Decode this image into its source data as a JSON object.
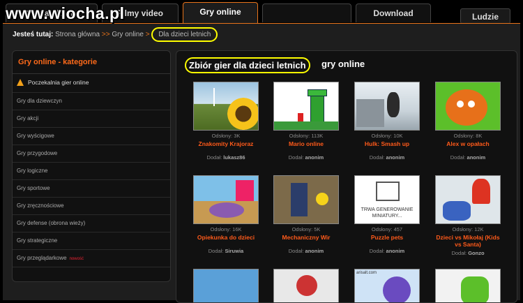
{
  "watermark": "www.wiocha.pl",
  "tabs": [
    {
      "label": "Strona główna"
    },
    {
      "label": "Filmy video"
    },
    {
      "label": "Gry online"
    },
    {
      "label": ""
    },
    {
      "label": "Download"
    },
    {
      "label": "Ludzie"
    }
  ],
  "breadcrumb": {
    "prefix": "Jesteś tutaj:",
    "home": "Strona główna",
    "sep": ">>",
    "section": "Gry online",
    "sep2": ">",
    "current": "Dla dzieci letnich"
  },
  "sidebar": {
    "title": "Gry online - kategorie",
    "items": [
      {
        "label": "Poczekalnia gier online"
      },
      {
        "label": "Gry dla dziewczyn"
      },
      {
        "label": "Gry akcji"
      },
      {
        "label": "Gry wyścigowe"
      },
      {
        "label": "Gry przygodowe"
      },
      {
        "label": "Gry logiczne"
      },
      {
        "label": "Gry sportowe"
      },
      {
        "label": "Gry zręcznościowe"
      },
      {
        "label": "Gry defense (obrona wieży)"
      },
      {
        "label": "Gry strategiczne"
      },
      {
        "label": "Gry przeglądarkowe",
        "badge": "nowość"
      }
    ]
  },
  "main": {
    "title": "Zbiór gier dla dzieci letnich",
    "title_suffix": "gry online",
    "games": [
      {
        "views": "Odsłony: 3K",
        "name": "Znakomity Krajoraz",
        "added_label": "Dodał:",
        "author": "lukasz86"
      },
      {
        "views": "Odsłony: 113K",
        "name": "Mario online",
        "added_label": "Dodał:",
        "author": "anonim"
      },
      {
        "views": "Odsłony: 10K",
        "name": "Hulk: Smash up",
        "added_label": "Dodał:",
        "author": "anonim"
      },
      {
        "views": "Odsłony: 8K",
        "name": "Alex w opałach",
        "added_label": "Dodał:",
        "author": "anonim"
      },
      {
        "views": "Odsłony: 16K",
        "name": "Opiekunka do dzieci",
        "added_label": "Dodał:",
        "author": "Siruwia"
      },
      {
        "views": "Odsłony: 5K",
        "name": "Mechaniczny Wir",
        "added_label": "Dodał:",
        "author": "anonim"
      },
      {
        "views": "Odsłony: 457",
        "name": "Puzzle pets",
        "added_label": "Dodał:",
        "author": "anonim"
      },
      {
        "views": "Odsłony: 12K",
        "name": "Dzieci vs Mikołaj (Kids vs Santa)",
        "added_label": "Dodał:",
        "author": "Gonzo"
      }
    ],
    "thumb_text": {
      "puzzle": "TRWA GENEROWANIE MINIATURY...",
      "site": "arisalt.com"
    }
  },
  "colors": {
    "accent": "#e8731a",
    "link": "#ff5a1a",
    "highlight": "#ffff00"
  }
}
